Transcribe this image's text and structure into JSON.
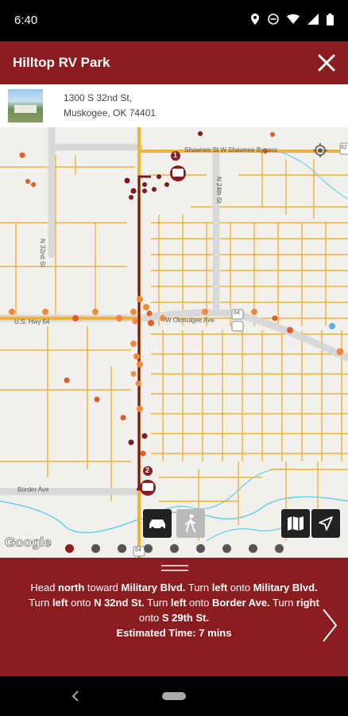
{
  "status_bar": {
    "time": "6:40"
  },
  "header": {
    "title": "Hilltop RV Park"
  },
  "address": {
    "line1": "1300 S 32nd St,",
    "line2": "Muskogee, OK 74401"
  },
  "map": {
    "street_labels": {
      "shawnee": "Shawnee St  W Shawnee Bypass",
      "n32nd": "N 32nd St",
      "n24th": "N 24th St",
      "okmulgee": "W Okmulgee Ave",
      "us64": "U.S. Hwy 64",
      "border": "Border Ave",
      "hwy62": "62",
      "hwy64a": "64",
      "hwy64b": "64"
    },
    "markers": {
      "start": "1",
      "end": "2"
    },
    "google": "Google",
    "page_dots": 9,
    "active_dot": 0
  },
  "directions": {
    "p1": "Head ",
    "b1": "north",
    "p2": " toward ",
    "b2": "Military Blvd.",
    "p3": " Turn ",
    "b3": "left",
    "p4": " onto ",
    "b4": "Military Blvd.",
    "p5": " Turn ",
    "b5": "left",
    "p6": " onto ",
    "b6": "N 32nd St.",
    "p7": " Turn ",
    "b7": "left",
    "p8": " onto ",
    "b8": "Border Ave.",
    "p9": " Turn ",
    "b9": "right",
    "p10": " onto ",
    "b10": "S 29th St.",
    "eta": "Estimated Time: 7 mins"
  },
  "colors": {
    "brand": "#8b1c1f",
    "road": "#f2b233",
    "route": "#7a1a1d",
    "highway": "#d8d8d8"
  }
}
